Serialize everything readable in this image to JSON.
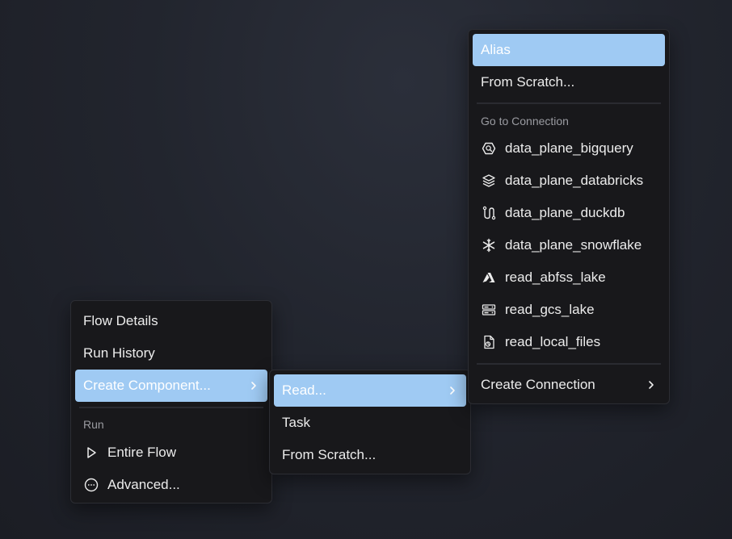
{
  "main_menu": {
    "flow_details": "Flow Details",
    "run_history": "Run History",
    "create_component": "Create Component...",
    "run_section_label": "Run",
    "entire_flow": "Entire Flow",
    "advanced": "Advanced..."
  },
  "create_submenu": {
    "read": "Read...",
    "task": "Task",
    "from_scratch": "From Scratch..."
  },
  "read_submenu": {
    "alias": "Alias",
    "from_scratch": "From Scratch...",
    "connection_section_label": "Go to Connection",
    "connections": [
      {
        "label": "data_plane_bigquery",
        "icon": "bigquery-icon"
      },
      {
        "label": "data_plane_databricks",
        "icon": "databricks-icon"
      },
      {
        "label": "data_plane_duckdb",
        "icon": "duckdb-icon"
      },
      {
        "label": "data_plane_snowflake",
        "icon": "snowflake-icon"
      },
      {
        "label": "read_abfss_lake",
        "icon": "azure-icon"
      },
      {
        "label": "read_gcs_lake",
        "icon": "gcs-icon"
      },
      {
        "label": "read_local_files",
        "icon": "local-file-icon"
      }
    ],
    "create_connection": "Create Connection"
  },
  "colors": {
    "highlight": "#9fcaf3",
    "menu_bg": "#18181b",
    "section_label": "#9a9ba1"
  }
}
